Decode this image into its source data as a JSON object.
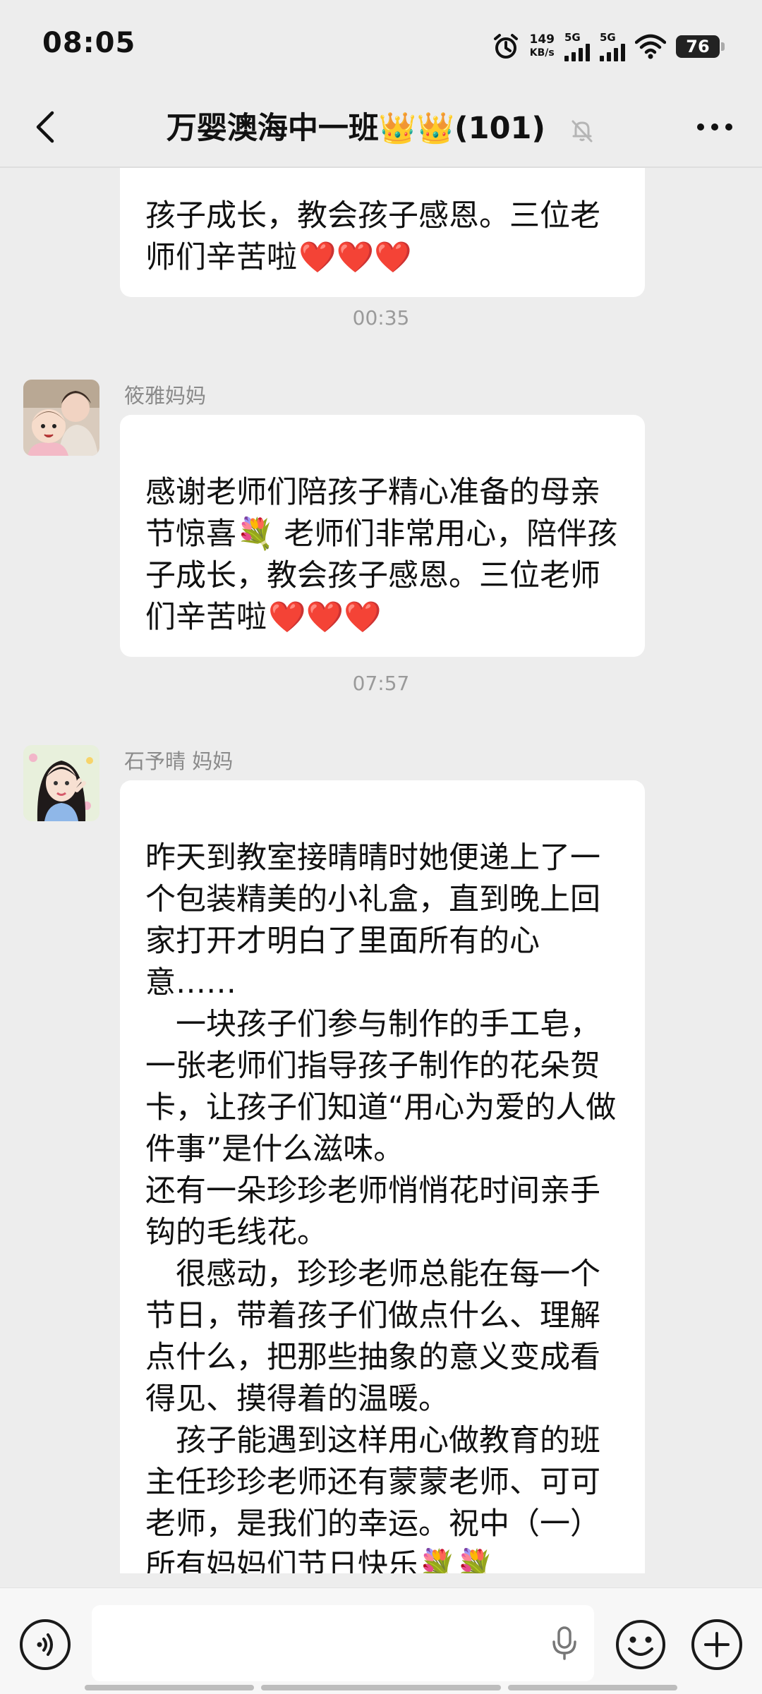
{
  "status_bar": {
    "time": "08:05",
    "net_speed_value": "149",
    "net_speed_unit": "KB/s",
    "signal1_label": "5G",
    "signal2_label": "5G",
    "battery": "76"
  },
  "header": {
    "title": "万婴澳海中一班👑👑(101)",
    "muted": true
  },
  "messages": {
    "partial_text": "孩子成长，教会孩子感恩。三位老师们辛苦啦",
    "partial_emoji": "❤️❤️❤️",
    "time1": "00:35",
    "msg1_sender": "筱雅妈妈",
    "msg1_text": "感谢老师们陪孩子精心准备的母亲节惊喜💐 老师们非常用心，陪伴孩子成长，教会孩子感恩。三位老师们辛苦啦",
    "msg1_emoji": "❤️❤️❤️",
    "time2": "07:57",
    "msg2_sender": "石予晴 妈妈",
    "msg2_text": "昨天到教室接晴晴时她便递上了一个包装精美的小礼盒，直到晚上回家打开才明白了里面所有的心意……\n　一块孩子们参与制作的手工皂，一张老师们指导孩子制作的花朵贺卡，让孩子们知道“用心为爱的人做件事”是什么滋味。\n还有一朵珍珍老师悄悄花时间亲手钩的毛线花。\n　很感动，珍珍老师总能在每一个节日，带着孩子们做点什么、理解点什么，把那些抽象的意义变成看得见、摸得着的温暖。\n　孩子能遇到这样用心做教育的班主任珍珍老师还有蒙蒙老师、可可老师，是我们的幸运。祝中（一）所有妈妈们节日快乐💐💐"
  },
  "colors": {
    "background": "#ededed",
    "bubble": "#ffffff",
    "timestamp": "#9a9a9a"
  },
  "icons": [
    "back-icon",
    "mute-bell-icon",
    "more-icon",
    "voice-icon",
    "microphone-icon",
    "emoji-icon",
    "plus-icon"
  ]
}
